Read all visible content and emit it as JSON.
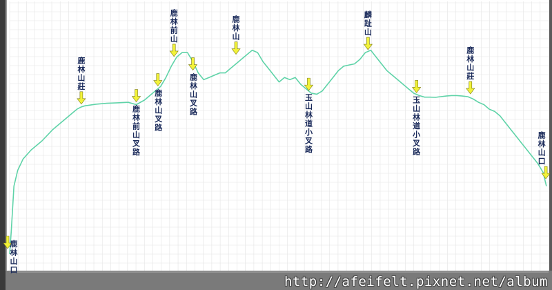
{
  "chart_data": {
    "type": "line",
    "title": "",
    "xlabel": "",
    "ylabel": "",
    "grid": true,
    "x_range": [
      0,
      100
    ],
    "y_range": [
      0,
      100
    ],
    "series": [
      {
        "color": "#5fd3a8",
        "x": [
          0.0,
          0.3,
          0.8,
          1.5,
          2.5,
          4,
          6,
          8,
          10,
          11.5,
          12.5,
          13.3,
          14,
          16,
          18,
          20,
          22,
          23.5,
          25,
          26.5,
          28,
          29,
          30,
          31,
          32,
          33,
          34,
          35,
          36,
          37,
          38,
          39,
          40,
          41,
          42,
          43,
          44,
          45,
          46,
          47,
          48,
          49,
          50,
          51,
          52,
          53,
          54,
          55,
          56,
          57,
          58,
          59,
          60,
          61,
          62,
          63,
          64,
          65,
          66,
          67,
          68,
          69,
          70,
          71,
          72,
          73,
          74,
          75,
          76,
          77,
          78,
          79,
          80,
          81,
          82,
          83,
          84,
          85,
          86,
          87,
          88,
          89,
          90,
          91,
          92,
          93,
          94,
          95,
          96,
          97,
          98,
          99,
          99.4,
          99.6
        ],
        "y": [
          0,
          10,
          30,
          37,
          42,
          46,
          50,
          55,
          59,
          62,
          64,
          65,
          65.5,
          66.2,
          66.6,
          66.8,
          67,
          66,
          68,
          71,
          74,
          78,
          83,
          87,
          89,
          89,
          85,
          80,
          77,
          78,
          79,
          80,
          80,
          82,
          84,
          86,
          88,
          90,
          89,
          85,
          82,
          79,
          76,
          78,
          77,
          78,
          75,
          73,
          71,
          70.6,
          72,
          75,
          78,
          81,
          83,
          83.5,
          84,
          86,
          89,
          90,
          87,
          84,
          81,
          79,
          77,
          75,
          73,
          71,
          70,
          69.3,
          69.3,
          69.2,
          69.5,
          69.8,
          70,
          70,
          69.8,
          69.5,
          68.5,
          67,
          66,
          64,
          63,
          61,
          58,
          55,
          52,
          49,
          46,
          43,
          40,
          36,
          32,
          30
        ]
      }
    ],
    "annotations": [
      {
        "text": "鹿林山口",
        "x": 0.0,
        "y": 0,
        "arrow_side": "left"
      },
      {
        "text": "鹿林山莊",
        "x": 13.3,
        "y": 65,
        "arrow_side": "above"
      },
      {
        "text": "鹿林前山叉路",
        "x": 23.5,
        "y": 66,
        "arrow_side": "above"
      },
      {
        "text": "鹿林山叉路",
        "x": 27.5,
        "y": 73,
        "arrow_side": "above"
      },
      {
        "text": "鹿林前山",
        "x": 30.5,
        "y": 86,
        "arrow_side": "above"
      },
      {
        "text": "鹿林山叉路",
        "x": 34,
        "y": 80,
        "arrow_side": "above"
      },
      {
        "text": "鹿林山",
        "x": 42,
        "y": 87,
        "arrow_side": "above"
      },
      {
        "text": "玉山林道小叉路",
        "x": 55.5,
        "y": 71,
        "arrow_side": "above"
      },
      {
        "text": "麟趾山",
        "x": 66.5,
        "y": 89,
        "arrow_side": "above"
      },
      {
        "text": "玉山林道小叉路",
        "x": 75.5,
        "y": 70,
        "arrow_side": "above"
      },
      {
        "text": "鹿林山莊",
        "x": 85.5,
        "y": 69.5,
        "arrow_side": "above"
      },
      {
        "text": "鹿林山口",
        "x": 99.5,
        "y": 32,
        "arrow_side": "above"
      }
    ]
  },
  "watermark": "http://afeifelt.pixnet.net/album",
  "colors": {
    "line": "#5fd3a8",
    "arrow": "#f2f23a",
    "label": "#1a2a5a",
    "grid": "#e4e4e4",
    "bottom_bar": "#7a7a7a"
  }
}
